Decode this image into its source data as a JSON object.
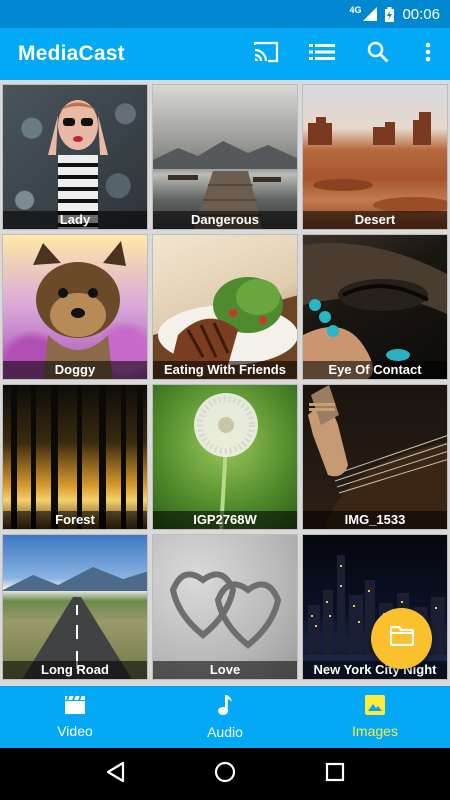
{
  "status_bar": {
    "network": "4G",
    "time": "00:06"
  },
  "app_bar": {
    "title": "MediaCast",
    "actions": [
      "cast-icon",
      "list-icon",
      "search-icon",
      "more-vert-icon"
    ]
  },
  "images": [
    {
      "caption": "Lady"
    },
    {
      "caption": "Dangerous"
    },
    {
      "caption": "Desert"
    },
    {
      "caption": "Doggy"
    },
    {
      "caption": "Eating With Friends"
    },
    {
      "caption": "Eye Of Contact"
    },
    {
      "caption": "Forest"
    },
    {
      "caption": "IGP2768W"
    },
    {
      "caption": "IMG_1533"
    },
    {
      "caption": "Long Road"
    },
    {
      "caption": "Love"
    },
    {
      "caption": "New York City Night"
    }
  ],
  "fab": {
    "icon": "folder-icon",
    "color": "#fbc02d"
  },
  "bottom_nav": {
    "items": [
      {
        "label": "Video",
        "icon": "video-icon"
      },
      {
        "label": "Audio",
        "icon": "music-note-icon"
      },
      {
        "label": "Images",
        "icon": "image-icon",
        "active": true
      }
    ]
  },
  "colors": {
    "primary": "#03a9f4",
    "primary_dark": "#0288d1",
    "active_nav": "#ffeb3b"
  }
}
